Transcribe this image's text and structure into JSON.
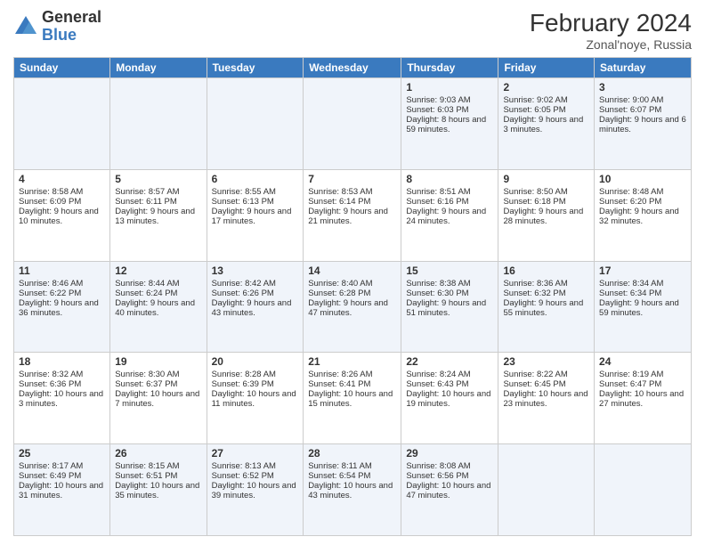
{
  "header": {
    "logo_general": "General",
    "logo_blue": "Blue",
    "month_title": "February 2024",
    "subtitle": "Zonal'noye, Russia"
  },
  "days_of_week": [
    "Sunday",
    "Monday",
    "Tuesday",
    "Wednesday",
    "Thursday",
    "Friday",
    "Saturday"
  ],
  "weeks": [
    [
      {
        "day": "",
        "info": ""
      },
      {
        "day": "",
        "info": ""
      },
      {
        "day": "",
        "info": ""
      },
      {
        "day": "",
        "info": ""
      },
      {
        "day": "1",
        "info": "Sunrise: 9:03 AM\nSunset: 6:03 PM\nDaylight: 8 hours and 59 minutes."
      },
      {
        "day": "2",
        "info": "Sunrise: 9:02 AM\nSunset: 6:05 PM\nDaylight: 9 hours and 3 minutes."
      },
      {
        "day": "3",
        "info": "Sunrise: 9:00 AM\nSunset: 6:07 PM\nDaylight: 9 hours and 6 minutes."
      }
    ],
    [
      {
        "day": "4",
        "info": "Sunrise: 8:58 AM\nSunset: 6:09 PM\nDaylight: 9 hours and 10 minutes."
      },
      {
        "day": "5",
        "info": "Sunrise: 8:57 AM\nSunset: 6:11 PM\nDaylight: 9 hours and 13 minutes."
      },
      {
        "day": "6",
        "info": "Sunrise: 8:55 AM\nSunset: 6:13 PM\nDaylight: 9 hours and 17 minutes."
      },
      {
        "day": "7",
        "info": "Sunrise: 8:53 AM\nSunset: 6:14 PM\nDaylight: 9 hours and 21 minutes."
      },
      {
        "day": "8",
        "info": "Sunrise: 8:51 AM\nSunset: 6:16 PM\nDaylight: 9 hours and 24 minutes."
      },
      {
        "day": "9",
        "info": "Sunrise: 8:50 AM\nSunset: 6:18 PM\nDaylight: 9 hours and 28 minutes."
      },
      {
        "day": "10",
        "info": "Sunrise: 8:48 AM\nSunset: 6:20 PM\nDaylight: 9 hours and 32 minutes."
      }
    ],
    [
      {
        "day": "11",
        "info": "Sunrise: 8:46 AM\nSunset: 6:22 PM\nDaylight: 9 hours and 36 minutes."
      },
      {
        "day": "12",
        "info": "Sunrise: 8:44 AM\nSunset: 6:24 PM\nDaylight: 9 hours and 40 minutes."
      },
      {
        "day": "13",
        "info": "Sunrise: 8:42 AM\nSunset: 6:26 PM\nDaylight: 9 hours and 43 minutes."
      },
      {
        "day": "14",
        "info": "Sunrise: 8:40 AM\nSunset: 6:28 PM\nDaylight: 9 hours and 47 minutes."
      },
      {
        "day": "15",
        "info": "Sunrise: 8:38 AM\nSunset: 6:30 PM\nDaylight: 9 hours and 51 minutes."
      },
      {
        "day": "16",
        "info": "Sunrise: 8:36 AM\nSunset: 6:32 PM\nDaylight: 9 hours and 55 minutes."
      },
      {
        "day": "17",
        "info": "Sunrise: 8:34 AM\nSunset: 6:34 PM\nDaylight: 9 hours and 59 minutes."
      }
    ],
    [
      {
        "day": "18",
        "info": "Sunrise: 8:32 AM\nSunset: 6:36 PM\nDaylight: 10 hours and 3 minutes."
      },
      {
        "day": "19",
        "info": "Sunrise: 8:30 AM\nSunset: 6:37 PM\nDaylight: 10 hours and 7 minutes."
      },
      {
        "day": "20",
        "info": "Sunrise: 8:28 AM\nSunset: 6:39 PM\nDaylight: 10 hours and 11 minutes."
      },
      {
        "day": "21",
        "info": "Sunrise: 8:26 AM\nSunset: 6:41 PM\nDaylight: 10 hours and 15 minutes."
      },
      {
        "day": "22",
        "info": "Sunrise: 8:24 AM\nSunset: 6:43 PM\nDaylight: 10 hours and 19 minutes."
      },
      {
        "day": "23",
        "info": "Sunrise: 8:22 AM\nSunset: 6:45 PM\nDaylight: 10 hours and 23 minutes."
      },
      {
        "day": "24",
        "info": "Sunrise: 8:19 AM\nSunset: 6:47 PM\nDaylight: 10 hours and 27 minutes."
      }
    ],
    [
      {
        "day": "25",
        "info": "Sunrise: 8:17 AM\nSunset: 6:49 PM\nDaylight: 10 hours and 31 minutes."
      },
      {
        "day": "26",
        "info": "Sunrise: 8:15 AM\nSunset: 6:51 PM\nDaylight: 10 hours and 35 minutes."
      },
      {
        "day": "27",
        "info": "Sunrise: 8:13 AM\nSunset: 6:52 PM\nDaylight: 10 hours and 39 minutes."
      },
      {
        "day": "28",
        "info": "Sunrise: 8:11 AM\nSunset: 6:54 PM\nDaylight: 10 hours and 43 minutes."
      },
      {
        "day": "29",
        "info": "Sunrise: 8:08 AM\nSunset: 6:56 PM\nDaylight: 10 hours and 47 minutes."
      },
      {
        "day": "",
        "info": ""
      },
      {
        "day": "",
        "info": ""
      }
    ]
  ]
}
